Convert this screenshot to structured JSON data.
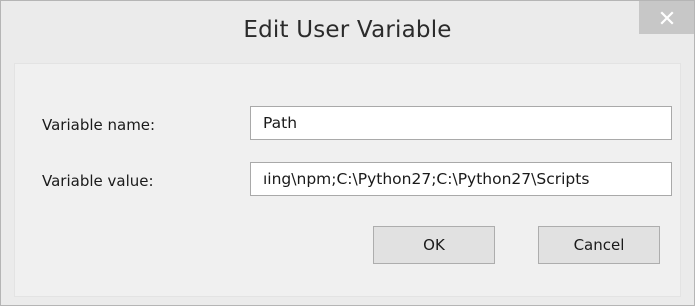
{
  "window": {
    "title": "Edit User Variable",
    "close_icon": "close-icon"
  },
  "form": {
    "name_label": "Variable name:",
    "name_value": "Path",
    "value_label": "Variable value:",
    "value_value": "ıing\\npm;C:\\Python27;C:\\Python27\\Scripts"
  },
  "buttons": {
    "ok_label": "OK",
    "cancel_label": "Cancel"
  }
}
